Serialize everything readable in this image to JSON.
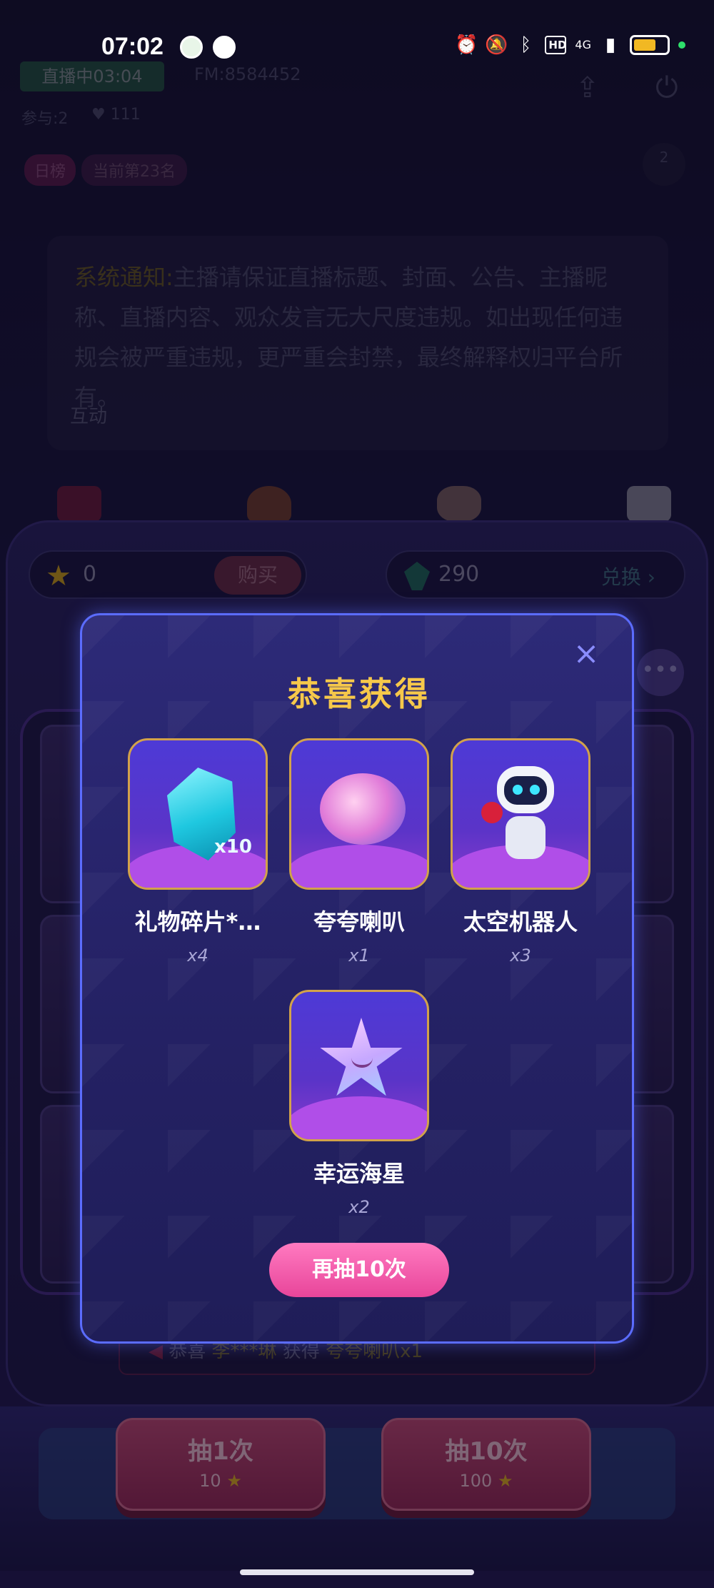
{
  "status_bar": {
    "time": "07:02",
    "network": "4G",
    "hd_label": "HD"
  },
  "room": {
    "live_badge": "直播中03:04",
    "fm_id": "FM:8584452",
    "participants": "参与:2",
    "likes": "111",
    "rank_tag": "日榜",
    "rank_text": "当前第23名",
    "online_count": "2",
    "notice_label": "系统通知:",
    "notice_text": "主播请保证直播标题、封面、公告、主播昵称、直播内容、观众发言无大尺度违规。如出现任何违规会被严重违规，更严重会封禁，最终解释权归平台所有。",
    "section_interact": "互动"
  },
  "machine": {
    "coins": "0",
    "buy_label": "购买",
    "gems": "290",
    "exchange_label": "兑换",
    "more_label": "•••",
    "ticker_prefix": "恭喜",
    "ticker_user": "李***琳",
    "ticker_mid": "获得",
    "ticker_prize": "夸夸喇叭x1",
    "draw_once": {
      "label": "抽1次",
      "cost": "10"
    },
    "draw_ten": {
      "label": "抽10次",
      "cost": "100"
    }
  },
  "modal": {
    "title": "恭喜获得",
    "close_icon": "close-icon",
    "prizes": [
      {
        "name": "礼物碎片*…",
        "count": "x4",
        "icon": "crystal-shard-icon",
        "badge": "x10"
      },
      {
        "name": "夸夸喇叭",
        "count": "x1",
        "icon": "praise-horn-sticker-icon",
        "badge": ""
      },
      {
        "name": "太空机器人",
        "count": "x3",
        "icon": "space-robot-icon",
        "badge": ""
      },
      {
        "name": "幸运海星",
        "count": "x2",
        "icon": "lucky-starfish-icon",
        "badge": ""
      }
    ],
    "again_label": "再抽10次"
  },
  "colors": {
    "title_gold": "#f6c84a",
    "modal_border": "#5b6cff",
    "again_pink": "#ff7ac0",
    "card_border": "#d2a24a"
  }
}
